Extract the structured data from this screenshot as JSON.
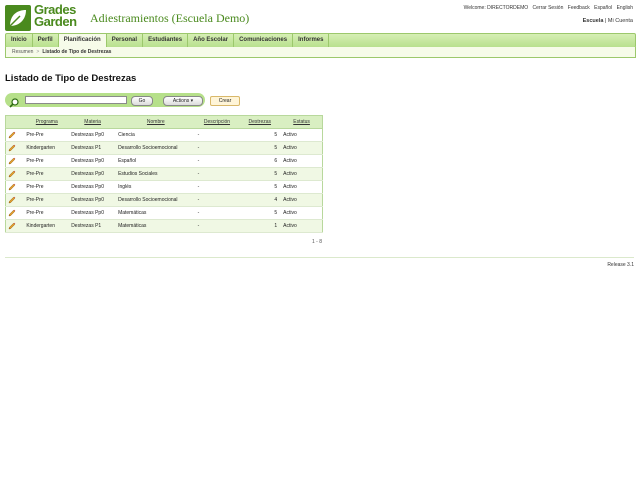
{
  "brand": {
    "line1": "Grades",
    "line2": "Garden"
  },
  "school_title": "Adiestramientos (Escuela Demo)",
  "top_links": {
    "welcome": "Welcome: DIRECTORDEMO",
    "logout": "Cerrar Sesión",
    "feedback": "Feedback",
    "spanish": "Español",
    "english": "English"
  },
  "top_right2": {
    "school": "Escuela",
    "sep": "|",
    "account": "Mi Cuenta"
  },
  "nav": {
    "items": [
      {
        "label": "Inicio"
      },
      {
        "label": "Perfil"
      },
      {
        "label": "Planificación"
      },
      {
        "label": "Personal"
      },
      {
        "label": "Estudiantes"
      },
      {
        "label": "Año Escolar"
      },
      {
        "label": "Comunicaciones"
      },
      {
        "label": "Informes"
      }
    ],
    "active_index": 2
  },
  "breadcrumb": {
    "root": "Resumen",
    "sep": ">",
    "current": "Listado de Tipo de Destrezas"
  },
  "page_title": "Listado de Tipo de Destrezas",
  "search": {
    "value": "",
    "go_label": "Go",
    "actions_label": "Actions ▾"
  },
  "create_label": "Crear",
  "table": {
    "headers": [
      "Programa",
      "Materia",
      "Nombre",
      "Descripción",
      "Destrezas",
      "Estatus"
    ],
    "rows": [
      {
        "programa": "Pre-Pre",
        "materia": "Destrezas Pp0",
        "nombre": "Ciencia",
        "descripcion": "-",
        "destrezas": "5",
        "estatus": "Activo"
      },
      {
        "programa": "Kindergarten",
        "materia": "Destrezas P1",
        "nombre": "Desarrollo Socioemocional",
        "descripcion": "-",
        "destrezas": "5",
        "estatus": "Activo"
      },
      {
        "programa": "Pre-Pre",
        "materia": "Destrezas Pp0",
        "nombre": "Español",
        "descripcion": "-",
        "destrezas": "6",
        "estatus": "Activo"
      },
      {
        "programa": "Pre-Pre",
        "materia": "Destrezas Pp0",
        "nombre": "Estudios Sociales",
        "descripcion": "-",
        "destrezas": "5",
        "estatus": "Activo"
      },
      {
        "programa": "Pre-Pre",
        "materia": "Destrezas Pp0",
        "nombre": "Inglés",
        "descripcion": "-",
        "destrezas": "5",
        "estatus": "Activo"
      },
      {
        "programa": "Pre-Pre",
        "materia": "Destrezas Pp0",
        "nombre": "Desarrollo Socioemocional",
        "descripcion": "-",
        "destrezas": "4",
        "estatus": "Activo"
      },
      {
        "programa": "Pre-Pre",
        "materia": "Destrezas Pp0",
        "nombre": "Matemáticas",
        "descripcion": "-",
        "destrezas": "5",
        "estatus": "Activo"
      },
      {
        "programa": "Kindergarten",
        "materia": "Destrezas P1",
        "nombre": "Matemáticas",
        "descripcion": "-",
        "destrezas": "1",
        "estatus": "Activo"
      }
    ]
  },
  "pager": "1 - 8",
  "release": "Release 3.1",
  "colors": {
    "brand_green": "#4a8a1e",
    "nav_green": "#b8e08e",
    "row_alt": "#f0f8e4"
  },
  "icons": {
    "logo": "leaf-logo-icon",
    "search": "magnifier-icon",
    "edit": "pencil-icon"
  }
}
